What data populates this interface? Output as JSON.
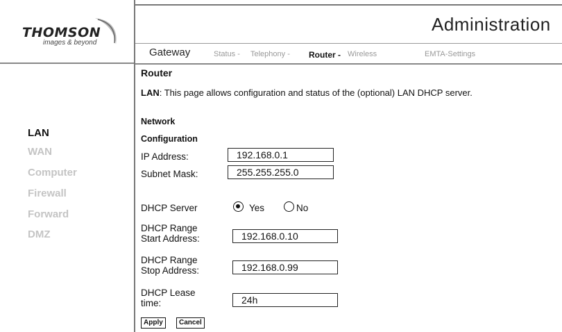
{
  "brand": {
    "name": "THOMSON",
    "tagline": "images & beyond"
  },
  "header": {
    "title": "Administration"
  },
  "tabs": {
    "gateway": "Gateway",
    "status": "Status -",
    "telephony": "Telephony -",
    "router": "Router -",
    "wireless": "Wireless",
    "emta": "EMTA-Settings"
  },
  "sidebar": {
    "items": [
      {
        "label": "LAN",
        "active": true
      },
      {
        "label": "WAN"
      },
      {
        "label": "Computer"
      },
      {
        "label": "Firewall"
      },
      {
        "label": "Forward"
      },
      {
        "label": "DMZ"
      }
    ]
  },
  "page": {
    "heading": "Router",
    "desc_bold": "LAN",
    "desc_text": ": This page allows configuration and status of the (optional) LAN DHCP server.",
    "section_line1": "Network",
    "section_line2": "Configuration"
  },
  "form": {
    "ip_label": "IP Address:",
    "ip_value": "192.168.0.1",
    "subnet_label": "Subnet Mask:",
    "subnet_value": "255.255.255.0",
    "dhcp_label": "DHCP Server",
    "dhcp_yes": "Yes",
    "dhcp_no": "No",
    "start_label_1": "DHCP Range",
    "start_label_2": "Start Address:",
    "start_value": "192.168.0.10",
    "stop_label_1": "DHCP Range",
    "stop_label_2": "Stop Address:",
    "stop_value": "192.168.0.99",
    "lease_label_1": "DHCP Lease",
    "lease_label_2": "time:",
    "lease_value": "24h",
    "apply": "Apply",
    "cancel": "Cancel"
  }
}
